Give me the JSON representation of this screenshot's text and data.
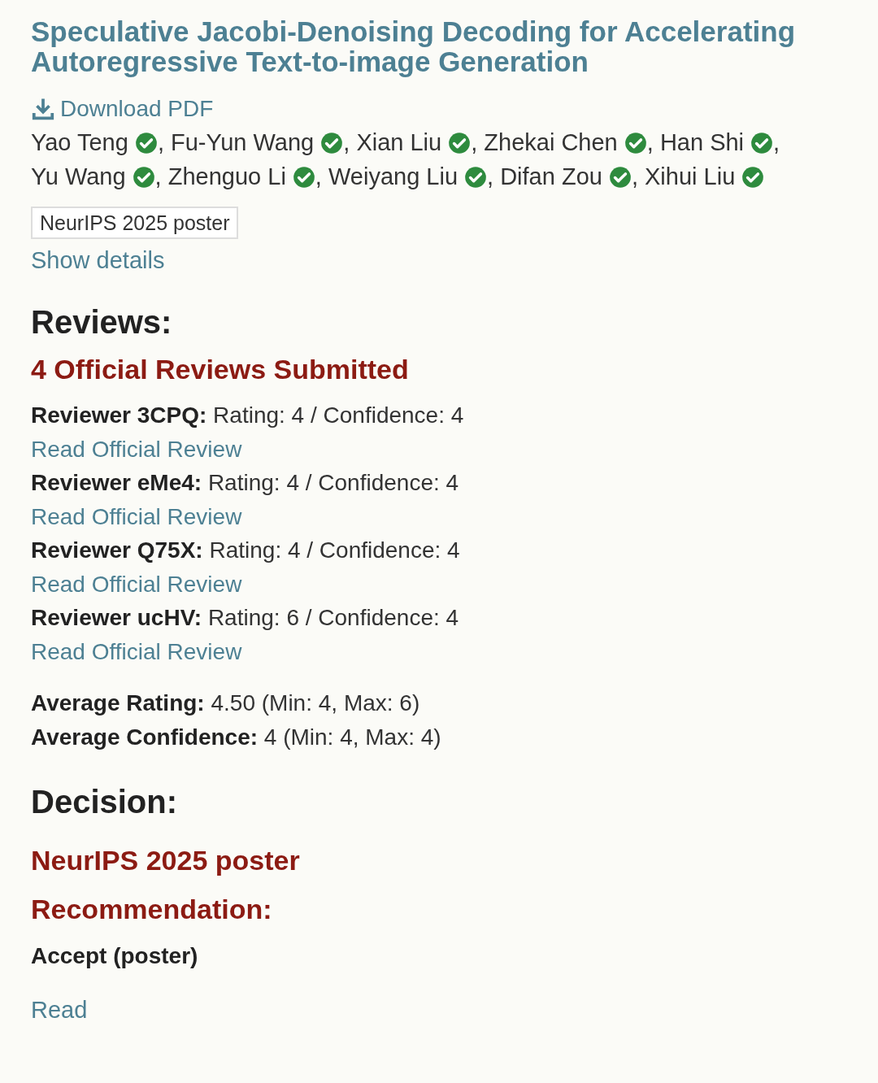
{
  "title": "Speculative Jacobi-Denoising Decoding for Accelerating Autoregressive Text-to-image Generation",
  "download": {
    "label": "Download PDF"
  },
  "authors": [
    {
      "name": "Yao Teng",
      "verified": true
    },
    {
      "prefix": ", ",
      "name": "Fu-Yun Wang",
      "verified": true
    },
    {
      "prefix": ", ",
      "name": "Xian Liu",
      "verified": true
    },
    {
      "prefix": ", ",
      "name": "Zhekai Chen",
      "verified": true
    },
    {
      "prefix": ", ",
      "name": "Han Shi",
      "verified": true
    },
    {
      "prefix": ", ",
      "name": "Yu Wang",
      "verified": true
    },
    {
      "prefix": ", ",
      "name": "Zhenguo Li",
      "verified": true
    },
    {
      "prefix": ", ",
      "name": "Weiyang Liu",
      "verified": true
    },
    {
      "prefix": ", ",
      "name": "Difan Zou",
      "verified": true
    },
    {
      "prefix": ", ",
      "name": "Xihui Liu",
      "verified": true
    }
  ],
  "venue_badge": "NeurIPS 2025 poster",
  "show_details": "Show details",
  "reviews": {
    "heading": "Reviews:",
    "subheading": "4 Official Reviews Submitted",
    "items": [
      {
        "reviewer": "Reviewer 3CPQ:",
        "summary": "Rating: 4 / Confidence: 4",
        "link": "Read Official Review"
      },
      {
        "reviewer": "Reviewer eMe4:",
        "summary": "Rating: 4 / Confidence: 4",
        "link": "Read Official Review"
      },
      {
        "reviewer": "Reviewer Q75X:",
        "summary": "Rating: 4 / Confidence: 4",
        "link": "Read Official Review"
      },
      {
        "reviewer": "Reviewer ucHV:",
        "summary": "Rating: 6 / Confidence: 4",
        "link": "Read Official Review"
      }
    ],
    "averages": [
      {
        "label": "Average Rating:",
        "value": "4.50 (Min: 4, Max: 6)"
      },
      {
        "label": "Average Confidence:",
        "value": "4 (Min: 4, Max: 4)"
      }
    ]
  },
  "decision": {
    "heading": "Decision:",
    "venue": "NeurIPS 2025 poster",
    "recommendation_heading": "Recommendation:",
    "recommendation": "Accept (poster)",
    "link": "Read"
  }
}
